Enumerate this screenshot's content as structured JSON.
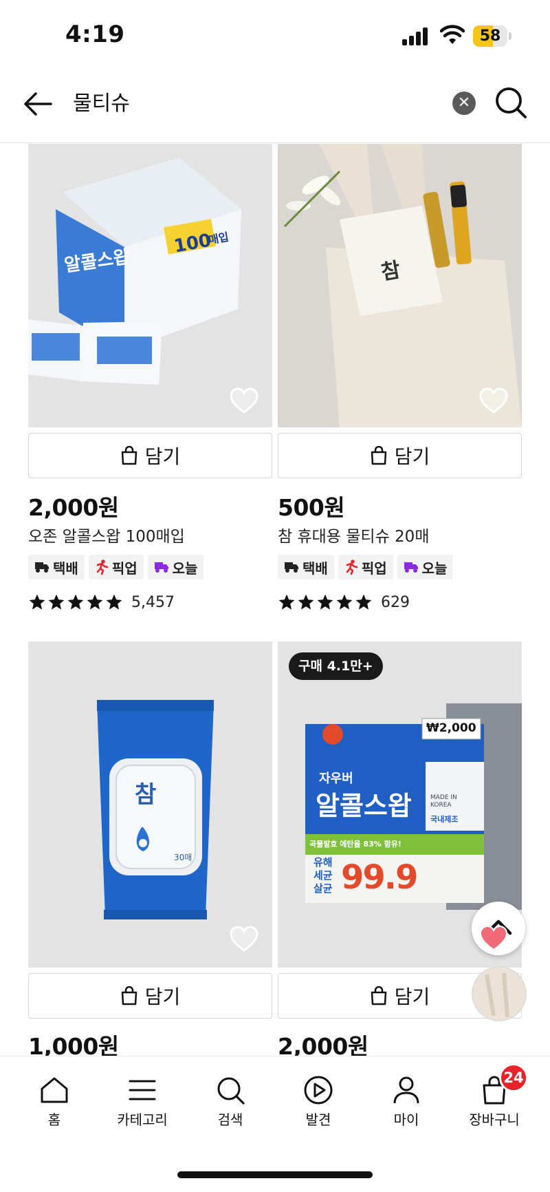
{
  "status_bar": {
    "time": "4:19",
    "battery": "58",
    "battery_level": 0.58
  },
  "search": {
    "query": "물티슈",
    "clear_icon": "close-icon",
    "search_icon": "search-icon"
  },
  "cart_button_label": "담기",
  "tags": {
    "delivery": "택배",
    "pickup": "픽업",
    "today": "오늘"
  },
  "products": [
    {
      "price": "2,000원",
      "name": "오존 알콜스왑 100매입",
      "rating_count": "5,457"
    },
    {
      "price": "500원",
      "name": "참 휴대용 물티슈 20매",
      "rating_count": "629"
    },
    {
      "price": "1,000원"
    },
    {
      "price": "2,000원",
      "badge": "구매 4.1만+"
    }
  ],
  "image_text": {
    "p1_brand": "알콜스왑",
    "p1_count": "100",
    "p1_count_unit": "매입",
    "p2_brand": "참",
    "p3_brand": "참",
    "p3_sub": "30매",
    "p4_top": "자우버",
    "p4_brand": "알콜스왑",
    "p4_percent": "99.9",
    "p4_price": "₩2,000",
    "p4_side": "유해\n세균\n살균",
    "p4_made": "MADE IN KOREA",
    "p4_domestic": "국내제조",
    "p4_strip": "곡물발효 에탄올 83% 함유!"
  },
  "bottom_nav": [
    {
      "label": "홈",
      "icon": "home-icon"
    },
    {
      "label": "카테고리",
      "icon": "menu-icon"
    },
    {
      "label": "검색",
      "icon": "search-icon"
    },
    {
      "label": "발견",
      "icon": "play-icon"
    },
    {
      "label": "마이",
      "icon": "person-icon"
    },
    {
      "label": "장바구니",
      "icon": "bag-icon",
      "badge": "24"
    }
  ],
  "colors": {
    "accent_red": "#e8242a",
    "star": "#111111",
    "tag_bg": "#f2f2f2"
  }
}
